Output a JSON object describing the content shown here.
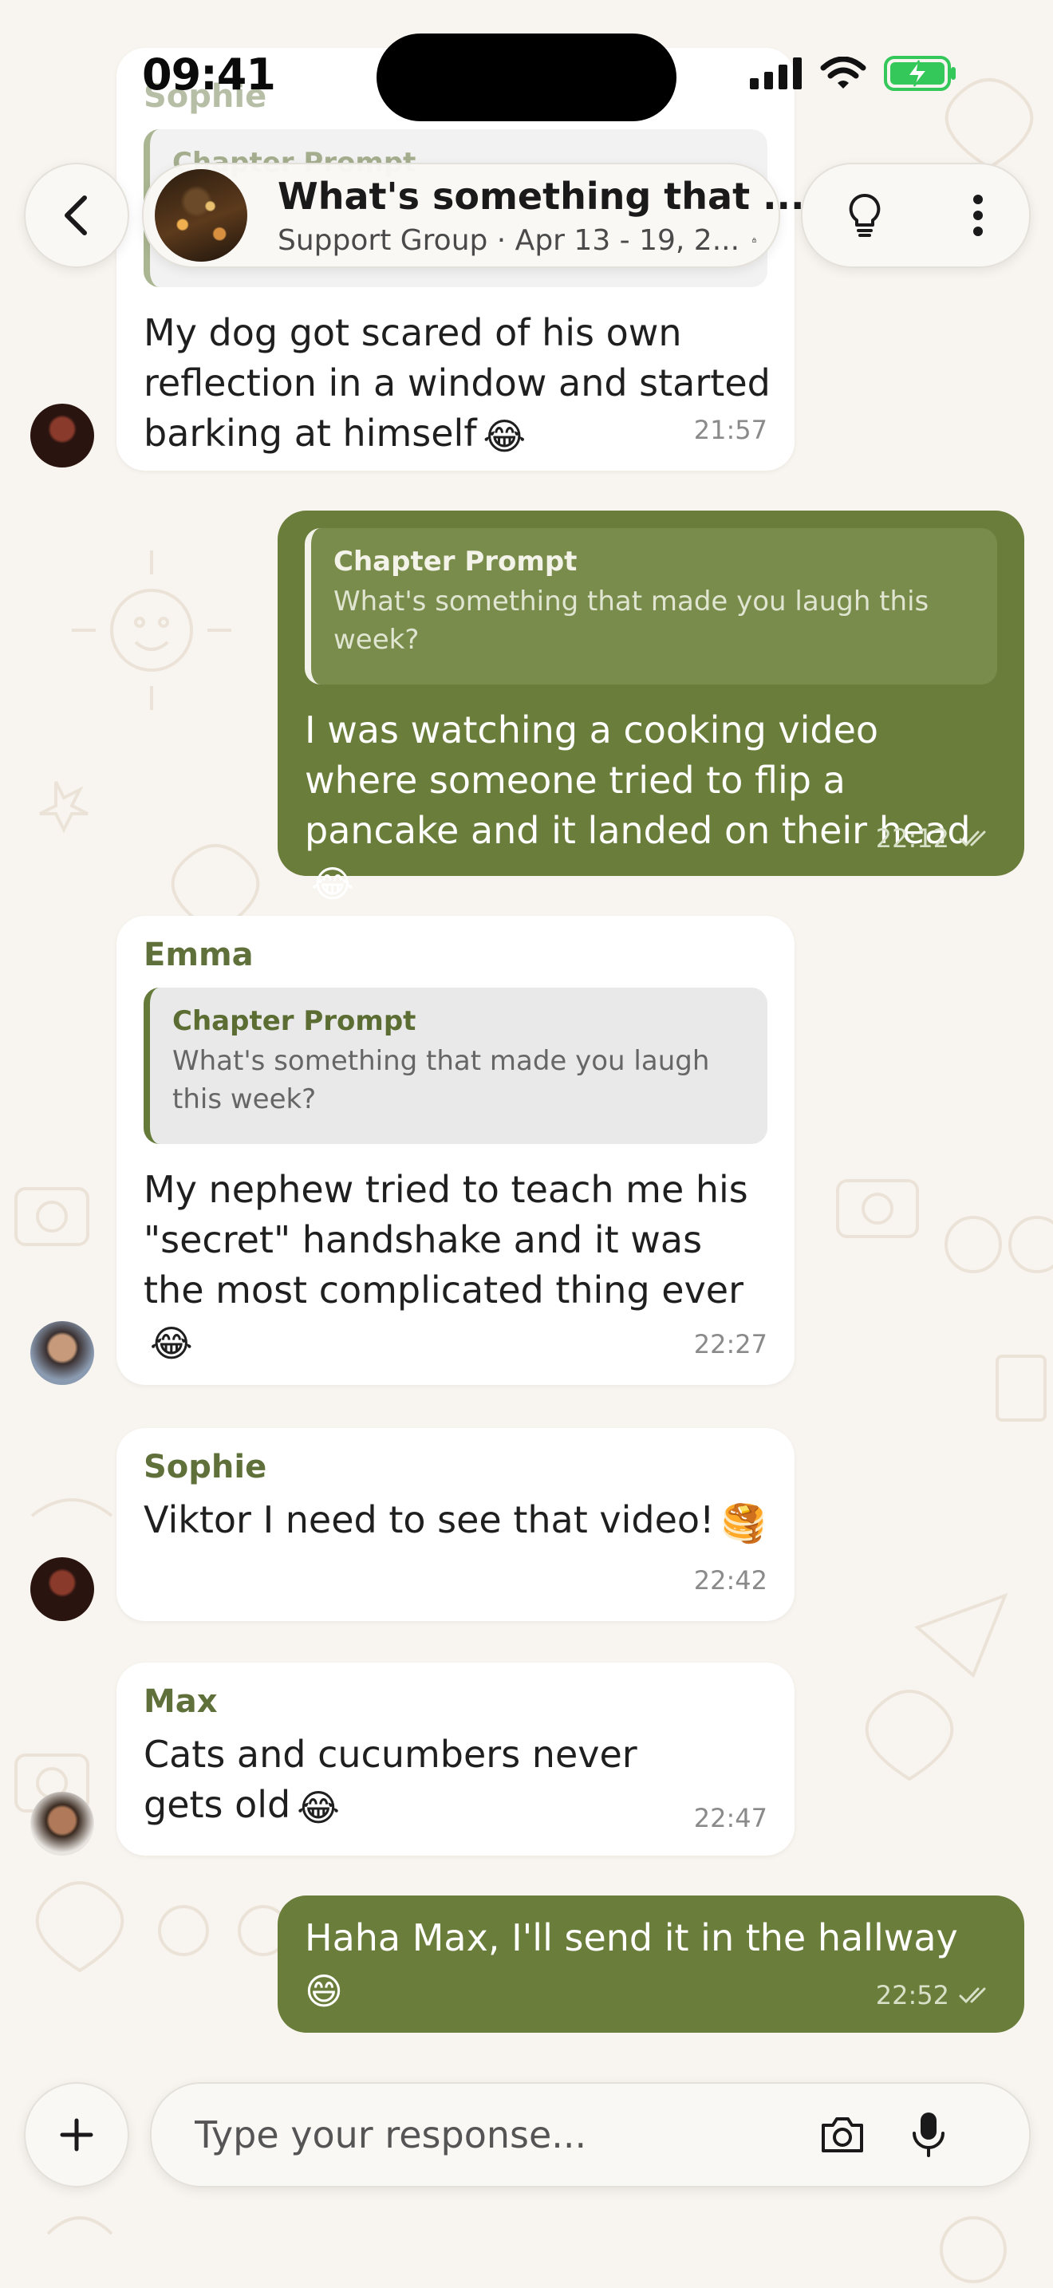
{
  "status_bar": {
    "time": "09:41"
  },
  "header": {
    "title": "What's something that ...",
    "subtitle": "Support Group · Apr 13 - 19, 2...",
    "back_icon": "chevron-left-icon",
    "lightbulb_icon": "lightbulb-icon",
    "more_icon": "more-vertical-icon"
  },
  "messages": [
    {
      "sender": "Sophie",
      "quote_title": "Chapter Prompt",
      "text": "My dog got scared of his own reflection in a window and started barking at himself",
      "emoji": "😂",
      "time": "21:57"
    },
    {
      "quote_title": "Chapter Prompt",
      "quote_text": "What's something that made you laugh this week?",
      "text": "I was watching a cooking video where someone tried to flip a pancake and it landed on their head",
      "emoji": "😂",
      "time": "22:12"
    },
    {
      "sender": "Emma",
      "quote_title": "Chapter Prompt",
      "quote_text": "What's something that made you laugh this week?",
      "text": "My nephew tried to teach me his \"secret\" handshake and it was the most complicated thing ever",
      "emoji": "😂",
      "time": "22:27"
    },
    {
      "sender": "Sophie",
      "text": "Viktor I need to see that video!",
      "emoji": "🥞",
      "time": "22:42"
    },
    {
      "sender": "Max",
      "text": "Cats and cucumbers never gets old",
      "emoji": "😂",
      "time": "22:47"
    },
    {
      "text": "Haha Max, I'll send it in the hallway",
      "emoji": "😄",
      "time": "22:52"
    }
  ],
  "composer": {
    "placeholder": "Type your response...",
    "add_icon": "plus-icon",
    "camera_icon": "camera-icon",
    "mic_icon": "microphone-icon"
  },
  "colors": {
    "background": "#f8f4ef",
    "accent": "#6a7d3a",
    "incoming_bubble": "#ffffff",
    "sender_name": "#60703a"
  }
}
